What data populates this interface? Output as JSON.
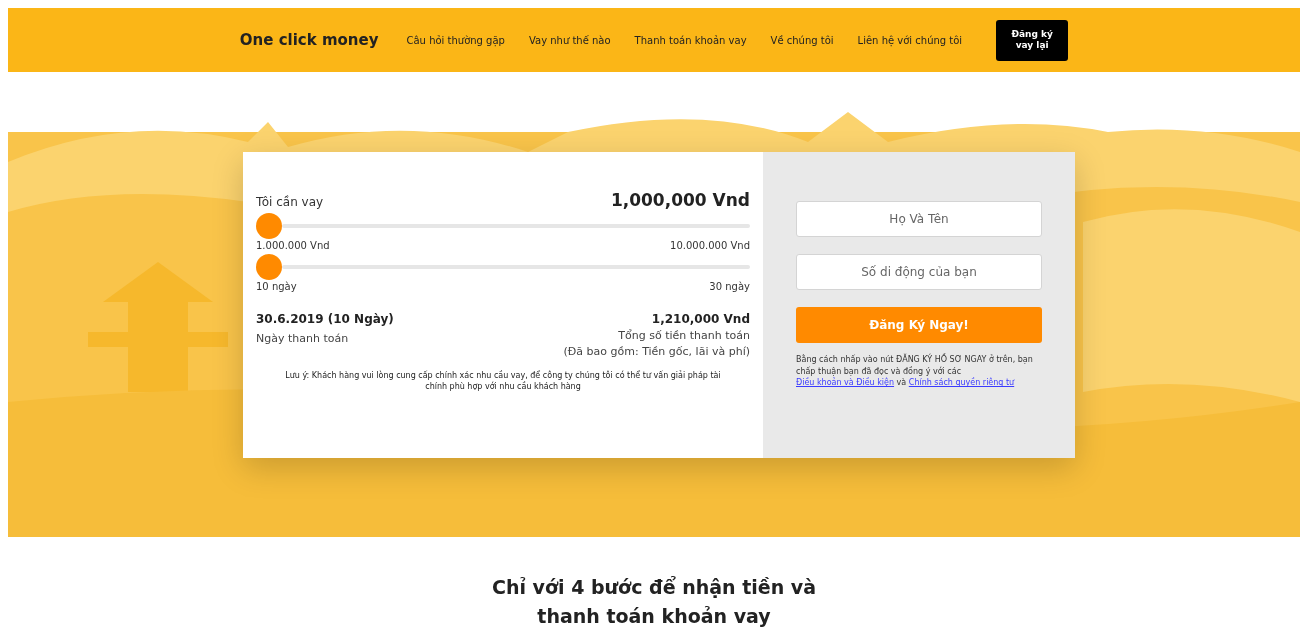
{
  "header": {
    "logo": "One click money",
    "nav": [
      "Câu hỏi thường gặp",
      "Vay như thế nào",
      "Thanh toán khoản vay",
      "Về chúng tôi",
      "Liên hệ với chúng tôi"
    ],
    "cta": "Đăng ký vay lại"
  },
  "calculator": {
    "label": "Tôi cần vay",
    "amount": "1,000,000 Vnd",
    "sliders": [
      {
        "level": 0,
        "min": "1.000.000 Vnd",
        "max": "10.000.000 Vnd"
      },
      {
        "level": 0,
        "min": "10 ngày",
        "max": "30 ngày"
      }
    ],
    "due_date": "30.6.2019 (10 Ngày)",
    "due_label": "Ngày thanh toán",
    "total": "1,210,000 Vnd",
    "total_label": "Tổng số tiền thanh toán",
    "total_note": "(Đã bao gồm: Tiền gốc, lãi và phí)",
    "note": "Lưu ý: Khách hàng vui lòng cung cấp chính xác nhu cầu vay, để công ty chúng tôi có thể tư vấn giải pháp tài chính phù hợp với nhu cầu khách hàng"
  },
  "form": {
    "fields": [
      {
        "placeholder": "Họ Và Tên"
      },
      {
        "placeholder": "Số di động của bạn"
      }
    ],
    "submit": "Đăng Ký Ngay!",
    "consent": "Bằng cách nhấp vào nút ĐĂNG KÝ HỒ SƠ NGAY ở trên, bạn chấp thuận bạn đã đọc và đồng ý với các ",
    "link_terms": "Điều khoản và Điều kiện",
    "joiner": " và ",
    "link_privacy": "Chính sách quyền riêng tư"
  },
  "steps_heading": "Chỉ với 4 bước để nhận tiền và thanh toán khoản vay"
}
